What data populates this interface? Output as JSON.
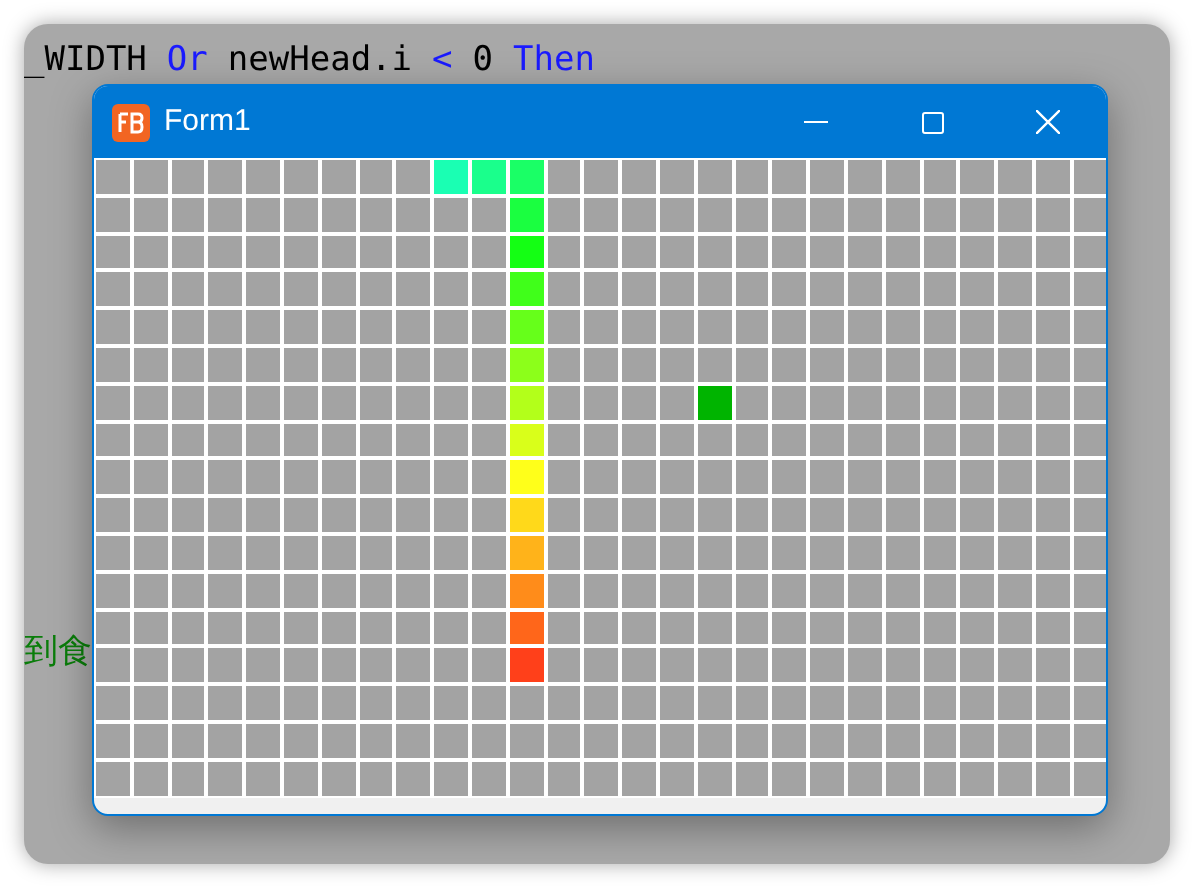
{
  "editor": {
    "code_line": [
      {
        "text": "_WIDTH",
        "kind": "plain"
      },
      {
        "text": "Or",
        "kind": "keyword"
      },
      {
        "text": "newHead.i",
        "kind": "plain"
      },
      {
        "text": "<",
        "kind": "keyword"
      },
      {
        "text": "0",
        "kind": "plain"
      },
      {
        "text": "Then",
        "kind": "keyword"
      }
    ],
    "comment": "到食"
  },
  "window": {
    "title": "Form1"
  },
  "board": {
    "rows": [
      {
        "cells": [
          {
            "kind": "empty"
          },
          {
            "kind": "empty"
          },
          {
            "kind": "empty"
          },
          {
            "kind": "empty"
          },
          {
            "kind": "empty"
          },
          {
            "kind": "empty"
          },
          {
            "kind": "empty"
          },
          {
            "kind": "empty"
          },
          {
            "kind": "empty"
          },
          {
            "kind": "snake",
            "color": "#1affb3"
          },
          {
            "kind": "snake",
            "color": "#1aff8c"
          },
          {
            "kind": "snake",
            "color": "#1aff66"
          },
          {
            "kind": "empty"
          },
          {
            "kind": "empty"
          },
          {
            "kind": "empty"
          },
          {
            "kind": "empty"
          },
          {
            "kind": "empty"
          },
          {
            "kind": "empty"
          },
          {
            "kind": "empty"
          },
          {
            "kind": "empty"
          },
          {
            "kind": "empty"
          },
          {
            "kind": "empty"
          },
          {
            "kind": "empty"
          },
          {
            "kind": "empty"
          },
          {
            "kind": "empty"
          },
          {
            "kind": "empty"
          },
          {
            "kind": "empty"
          }
        ]
      },
      {
        "cells": [
          {
            "kind": "empty"
          },
          {
            "kind": "empty"
          },
          {
            "kind": "empty"
          },
          {
            "kind": "empty"
          },
          {
            "kind": "empty"
          },
          {
            "kind": "empty"
          },
          {
            "kind": "empty"
          },
          {
            "kind": "empty"
          },
          {
            "kind": "empty"
          },
          {
            "kind": "empty"
          },
          {
            "kind": "empty"
          },
          {
            "kind": "snake",
            "color": "#1aff40"
          },
          {
            "kind": "empty"
          },
          {
            "kind": "empty"
          },
          {
            "kind": "empty"
          },
          {
            "kind": "empty"
          },
          {
            "kind": "empty"
          },
          {
            "kind": "empty"
          },
          {
            "kind": "empty"
          },
          {
            "kind": "empty"
          },
          {
            "kind": "empty"
          },
          {
            "kind": "empty"
          },
          {
            "kind": "empty"
          },
          {
            "kind": "empty"
          },
          {
            "kind": "empty"
          },
          {
            "kind": "empty"
          },
          {
            "kind": "empty"
          }
        ]
      },
      {
        "cells": [
          {
            "kind": "empty"
          },
          {
            "kind": "empty"
          },
          {
            "kind": "empty"
          },
          {
            "kind": "empty"
          },
          {
            "kind": "empty"
          },
          {
            "kind": "empty"
          },
          {
            "kind": "empty"
          },
          {
            "kind": "empty"
          },
          {
            "kind": "empty"
          },
          {
            "kind": "empty"
          },
          {
            "kind": "empty"
          },
          {
            "kind": "snake",
            "color": "#14ff14"
          },
          {
            "kind": "empty"
          },
          {
            "kind": "empty"
          },
          {
            "kind": "empty"
          },
          {
            "kind": "empty"
          },
          {
            "kind": "empty"
          },
          {
            "kind": "empty"
          },
          {
            "kind": "empty"
          },
          {
            "kind": "empty"
          },
          {
            "kind": "empty"
          },
          {
            "kind": "empty"
          },
          {
            "kind": "empty"
          },
          {
            "kind": "empty"
          },
          {
            "kind": "empty"
          },
          {
            "kind": "empty"
          },
          {
            "kind": "empty"
          }
        ]
      },
      {
        "cells": [
          {
            "kind": "empty"
          },
          {
            "kind": "empty"
          },
          {
            "kind": "empty"
          },
          {
            "kind": "empty"
          },
          {
            "kind": "empty"
          },
          {
            "kind": "empty"
          },
          {
            "kind": "empty"
          },
          {
            "kind": "empty"
          },
          {
            "kind": "empty"
          },
          {
            "kind": "empty"
          },
          {
            "kind": "empty"
          },
          {
            "kind": "snake",
            "color": "#40ff1a"
          },
          {
            "kind": "empty"
          },
          {
            "kind": "empty"
          },
          {
            "kind": "empty"
          },
          {
            "kind": "empty"
          },
          {
            "kind": "empty"
          },
          {
            "kind": "empty"
          },
          {
            "kind": "empty"
          },
          {
            "kind": "empty"
          },
          {
            "kind": "empty"
          },
          {
            "kind": "empty"
          },
          {
            "kind": "empty"
          },
          {
            "kind": "empty"
          },
          {
            "kind": "empty"
          },
          {
            "kind": "empty"
          },
          {
            "kind": "empty"
          }
        ]
      },
      {
        "cells": [
          {
            "kind": "empty"
          },
          {
            "kind": "empty"
          },
          {
            "kind": "empty"
          },
          {
            "kind": "empty"
          },
          {
            "kind": "empty"
          },
          {
            "kind": "empty"
          },
          {
            "kind": "empty"
          },
          {
            "kind": "empty"
          },
          {
            "kind": "empty"
          },
          {
            "kind": "empty"
          },
          {
            "kind": "empty"
          },
          {
            "kind": "snake",
            "color": "#66ff1a"
          },
          {
            "kind": "empty"
          },
          {
            "kind": "empty"
          },
          {
            "kind": "empty"
          },
          {
            "kind": "empty"
          },
          {
            "kind": "empty"
          },
          {
            "kind": "empty"
          },
          {
            "kind": "empty"
          },
          {
            "kind": "empty"
          },
          {
            "kind": "empty"
          },
          {
            "kind": "empty"
          },
          {
            "kind": "empty"
          },
          {
            "kind": "empty"
          },
          {
            "kind": "empty"
          },
          {
            "kind": "empty"
          },
          {
            "kind": "empty"
          }
        ]
      },
      {
        "cells": [
          {
            "kind": "empty"
          },
          {
            "kind": "empty"
          },
          {
            "kind": "empty"
          },
          {
            "kind": "empty"
          },
          {
            "kind": "empty"
          },
          {
            "kind": "empty"
          },
          {
            "kind": "empty"
          },
          {
            "kind": "empty"
          },
          {
            "kind": "empty"
          },
          {
            "kind": "empty"
          },
          {
            "kind": "empty"
          },
          {
            "kind": "snake",
            "color": "#8cff1a"
          },
          {
            "kind": "empty"
          },
          {
            "kind": "empty"
          },
          {
            "kind": "empty"
          },
          {
            "kind": "empty"
          },
          {
            "kind": "empty"
          },
          {
            "kind": "empty"
          },
          {
            "kind": "empty"
          },
          {
            "kind": "empty"
          },
          {
            "kind": "empty"
          },
          {
            "kind": "empty"
          },
          {
            "kind": "empty"
          },
          {
            "kind": "empty"
          },
          {
            "kind": "empty"
          },
          {
            "kind": "empty"
          },
          {
            "kind": "empty"
          }
        ]
      },
      {
        "cells": [
          {
            "kind": "empty"
          },
          {
            "kind": "empty"
          },
          {
            "kind": "empty"
          },
          {
            "kind": "empty"
          },
          {
            "kind": "empty"
          },
          {
            "kind": "empty"
          },
          {
            "kind": "empty"
          },
          {
            "kind": "empty"
          },
          {
            "kind": "empty"
          },
          {
            "kind": "empty"
          },
          {
            "kind": "empty"
          },
          {
            "kind": "snake",
            "color": "#b3ff1a"
          },
          {
            "kind": "empty"
          },
          {
            "kind": "empty"
          },
          {
            "kind": "empty"
          },
          {
            "kind": "empty"
          },
          {
            "kind": "food",
            "color": "#00b400"
          },
          {
            "kind": "empty"
          },
          {
            "kind": "empty"
          },
          {
            "kind": "empty"
          },
          {
            "kind": "empty"
          },
          {
            "kind": "empty"
          },
          {
            "kind": "empty"
          },
          {
            "kind": "empty"
          },
          {
            "kind": "empty"
          },
          {
            "kind": "empty"
          },
          {
            "kind": "empty"
          }
        ]
      },
      {
        "cells": [
          {
            "kind": "empty"
          },
          {
            "kind": "empty"
          },
          {
            "kind": "empty"
          },
          {
            "kind": "empty"
          },
          {
            "kind": "empty"
          },
          {
            "kind": "empty"
          },
          {
            "kind": "empty"
          },
          {
            "kind": "empty"
          },
          {
            "kind": "empty"
          },
          {
            "kind": "empty"
          },
          {
            "kind": "empty"
          },
          {
            "kind": "snake",
            "color": "#d9ff1a"
          },
          {
            "kind": "empty"
          },
          {
            "kind": "empty"
          },
          {
            "kind": "empty"
          },
          {
            "kind": "empty"
          },
          {
            "kind": "empty"
          },
          {
            "kind": "empty"
          },
          {
            "kind": "empty"
          },
          {
            "kind": "empty"
          },
          {
            "kind": "empty"
          },
          {
            "kind": "empty"
          },
          {
            "kind": "empty"
          },
          {
            "kind": "empty"
          },
          {
            "kind": "empty"
          },
          {
            "kind": "empty"
          },
          {
            "kind": "empty"
          }
        ]
      },
      {
        "cells": [
          {
            "kind": "empty"
          },
          {
            "kind": "empty"
          },
          {
            "kind": "empty"
          },
          {
            "kind": "empty"
          },
          {
            "kind": "empty"
          },
          {
            "kind": "empty"
          },
          {
            "kind": "empty"
          },
          {
            "kind": "empty"
          },
          {
            "kind": "empty"
          },
          {
            "kind": "empty"
          },
          {
            "kind": "empty"
          },
          {
            "kind": "snake",
            "color": "#ffff1a"
          },
          {
            "kind": "empty"
          },
          {
            "kind": "empty"
          },
          {
            "kind": "empty"
          },
          {
            "kind": "empty"
          },
          {
            "kind": "empty"
          },
          {
            "kind": "empty"
          },
          {
            "kind": "empty"
          },
          {
            "kind": "empty"
          },
          {
            "kind": "empty"
          },
          {
            "kind": "empty"
          },
          {
            "kind": "empty"
          },
          {
            "kind": "empty"
          },
          {
            "kind": "empty"
          },
          {
            "kind": "empty"
          },
          {
            "kind": "empty"
          }
        ]
      },
      {
        "cells": [
          {
            "kind": "empty"
          },
          {
            "kind": "empty"
          },
          {
            "kind": "empty"
          },
          {
            "kind": "empty"
          },
          {
            "kind": "empty"
          },
          {
            "kind": "empty"
          },
          {
            "kind": "empty"
          },
          {
            "kind": "empty"
          },
          {
            "kind": "empty"
          },
          {
            "kind": "empty"
          },
          {
            "kind": "empty"
          },
          {
            "kind": "snake",
            "color": "#ffd91a"
          },
          {
            "kind": "empty"
          },
          {
            "kind": "empty"
          },
          {
            "kind": "empty"
          },
          {
            "kind": "empty"
          },
          {
            "kind": "empty"
          },
          {
            "kind": "empty"
          },
          {
            "kind": "empty"
          },
          {
            "kind": "empty"
          },
          {
            "kind": "empty"
          },
          {
            "kind": "empty"
          },
          {
            "kind": "empty"
          },
          {
            "kind": "empty"
          },
          {
            "kind": "empty"
          },
          {
            "kind": "empty"
          },
          {
            "kind": "empty"
          }
        ]
      },
      {
        "cells": [
          {
            "kind": "empty"
          },
          {
            "kind": "empty"
          },
          {
            "kind": "empty"
          },
          {
            "kind": "empty"
          },
          {
            "kind": "empty"
          },
          {
            "kind": "empty"
          },
          {
            "kind": "empty"
          },
          {
            "kind": "empty"
          },
          {
            "kind": "empty"
          },
          {
            "kind": "empty"
          },
          {
            "kind": "empty"
          },
          {
            "kind": "snake",
            "color": "#ffb31a"
          },
          {
            "kind": "empty"
          },
          {
            "kind": "empty"
          },
          {
            "kind": "empty"
          },
          {
            "kind": "empty"
          },
          {
            "kind": "empty"
          },
          {
            "kind": "empty"
          },
          {
            "kind": "empty"
          },
          {
            "kind": "empty"
          },
          {
            "kind": "empty"
          },
          {
            "kind": "empty"
          },
          {
            "kind": "empty"
          },
          {
            "kind": "empty"
          },
          {
            "kind": "empty"
          },
          {
            "kind": "empty"
          },
          {
            "kind": "empty"
          }
        ]
      },
      {
        "cells": [
          {
            "kind": "empty"
          },
          {
            "kind": "empty"
          },
          {
            "kind": "empty"
          },
          {
            "kind": "empty"
          },
          {
            "kind": "empty"
          },
          {
            "kind": "empty"
          },
          {
            "kind": "empty"
          },
          {
            "kind": "empty"
          },
          {
            "kind": "empty"
          },
          {
            "kind": "empty"
          },
          {
            "kind": "empty"
          },
          {
            "kind": "snake",
            "color": "#ff8c1a"
          },
          {
            "kind": "empty"
          },
          {
            "kind": "empty"
          },
          {
            "kind": "empty"
          },
          {
            "kind": "empty"
          },
          {
            "kind": "empty"
          },
          {
            "kind": "empty"
          },
          {
            "kind": "empty"
          },
          {
            "kind": "empty"
          },
          {
            "kind": "empty"
          },
          {
            "kind": "empty"
          },
          {
            "kind": "empty"
          },
          {
            "kind": "empty"
          },
          {
            "kind": "empty"
          },
          {
            "kind": "empty"
          },
          {
            "kind": "empty"
          }
        ]
      },
      {
        "cells": [
          {
            "kind": "empty"
          },
          {
            "kind": "empty"
          },
          {
            "kind": "empty"
          },
          {
            "kind": "empty"
          },
          {
            "kind": "empty"
          },
          {
            "kind": "empty"
          },
          {
            "kind": "empty"
          },
          {
            "kind": "empty"
          },
          {
            "kind": "empty"
          },
          {
            "kind": "empty"
          },
          {
            "kind": "empty"
          },
          {
            "kind": "snake",
            "color": "#ff661a"
          },
          {
            "kind": "empty"
          },
          {
            "kind": "empty"
          },
          {
            "kind": "empty"
          },
          {
            "kind": "empty"
          },
          {
            "kind": "empty"
          },
          {
            "kind": "empty"
          },
          {
            "kind": "empty"
          },
          {
            "kind": "empty"
          },
          {
            "kind": "empty"
          },
          {
            "kind": "empty"
          },
          {
            "kind": "empty"
          },
          {
            "kind": "empty"
          },
          {
            "kind": "empty"
          },
          {
            "kind": "empty"
          },
          {
            "kind": "empty"
          }
        ]
      },
      {
        "cells": [
          {
            "kind": "empty"
          },
          {
            "kind": "empty"
          },
          {
            "kind": "empty"
          },
          {
            "kind": "empty"
          },
          {
            "kind": "empty"
          },
          {
            "kind": "empty"
          },
          {
            "kind": "empty"
          },
          {
            "kind": "empty"
          },
          {
            "kind": "empty"
          },
          {
            "kind": "empty"
          },
          {
            "kind": "empty"
          },
          {
            "kind": "snake",
            "color": "#ff401a"
          },
          {
            "kind": "empty"
          },
          {
            "kind": "empty"
          },
          {
            "kind": "empty"
          },
          {
            "kind": "empty"
          },
          {
            "kind": "empty"
          },
          {
            "kind": "empty"
          },
          {
            "kind": "empty"
          },
          {
            "kind": "empty"
          },
          {
            "kind": "empty"
          },
          {
            "kind": "empty"
          },
          {
            "kind": "empty"
          },
          {
            "kind": "empty"
          },
          {
            "kind": "empty"
          },
          {
            "kind": "empty"
          },
          {
            "kind": "empty"
          }
        ]
      },
      {
        "cells": [
          {
            "kind": "empty"
          },
          {
            "kind": "empty"
          },
          {
            "kind": "empty"
          },
          {
            "kind": "empty"
          },
          {
            "kind": "empty"
          },
          {
            "kind": "empty"
          },
          {
            "kind": "empty"
          },
          {
            "kind": "empty"
          },
          {
            "kind": "empty"
          },
          {
            "kind": "empty"
          },
          {
            "kind": "empty"
          },
          {
            "kind": "empty"
          },
          {
            "kind": "empty"
          },
          {
            "kind": "empty"
          },
          {
            "kind": "empty"
          },
          {
            "kind": "empty"
          },
          {
            "kind": "empty"
          },
          {
            "kind": "empty"
          },
          {
            "kind": "empty"
          },
          {
            "kind": "empty"
          },
          {
            "kind": "empty"
          },
          {
            "kind": "empty"
          },
          {
            "kind": "empty"
          },
          {
            "kind": "empty"
          },
          {
            "kind": "empty"
          },
          {
            "kind": "empty"
          },
          {
            "kind": "empty"
          }
        ]
      },
      {
        "cells": [
          {
            "kind": "empty"
          },
          {
            "kind": "empty"
          },
          {
            "kind": "empty"
          },
          {
            "kind": "empty"
          },
          {
            "kind": "empty"
          },
          {
            "kind": "empty"
          },
          {
            "kind": "empty"
          },
          {
            "kind": "empty"
          },
          {
            "kind": "empty"
          },
          {
            "kind": "empty"
          },
          {
            "kind": "empty"
          },
          {
            "kind": "empty"
          },
          {
            "kind": "empty"
          },
          {
            "kind": "empty"
          },
          {
            "kind": "empty"
          },
          {
            "kind": "empty"
          },
          {
            "kind": "empty"
          },
          {
            "kind": "empty"
          },
          {
            "kind": "empty"
          },
          {
            "kind": "empty"
          },
          {
            "kind": "empty"
          },
          {
            "kind": "empty"
          },
          {
            "kind": "empty"
          },
          {
            "kind": "empty"
          },
          {
            "kind": "empty"
          },
          {
            "kind": "empty"
          },
          {
            "kind": "empty"
          }
        ]
      },
      {
        "cells": [
          {
            "kind": "empty"
          },
          {
            "kind": "empty"
          },
          {
            "kind": "empty"
          },
          {
            "kind": "empty"
          },
          {
            "kind": "empty"
          },
          {
            "kind": "empty"
          },
          {
            "kind": "empty"
          },
          {
            "kind": "empty"
          },
          {
            "kind": "empty"
          },
          {
            "kind": "empty"
          },
          {
            "kind": "empty"
          },
          {
            "kind": "empty"
          },
          {
            "kind": "empty"
          },
          {
            "kind": "empty"
          },
          {
            "kind": "empty"
          },
          {
            "kind": "empty"
          },
          {
            "kind": "empty"
          },
          {
            "kind": "empty"
          },
          {
            "kind": "empty"
          },
          {
            "kind": "empty"
          },
          {
            "kind": "empty"
          },
          {
            "kind": "empty"
          },
          {
            "kind": "empty"
          },
          {
            "kind": "empty"
          },
          {
            "kind": "empty"
          },
          {
            "kind": "empty"
          },
          {
            "kind": "empty"
          }
        ]
      }
    ]
  }
}
